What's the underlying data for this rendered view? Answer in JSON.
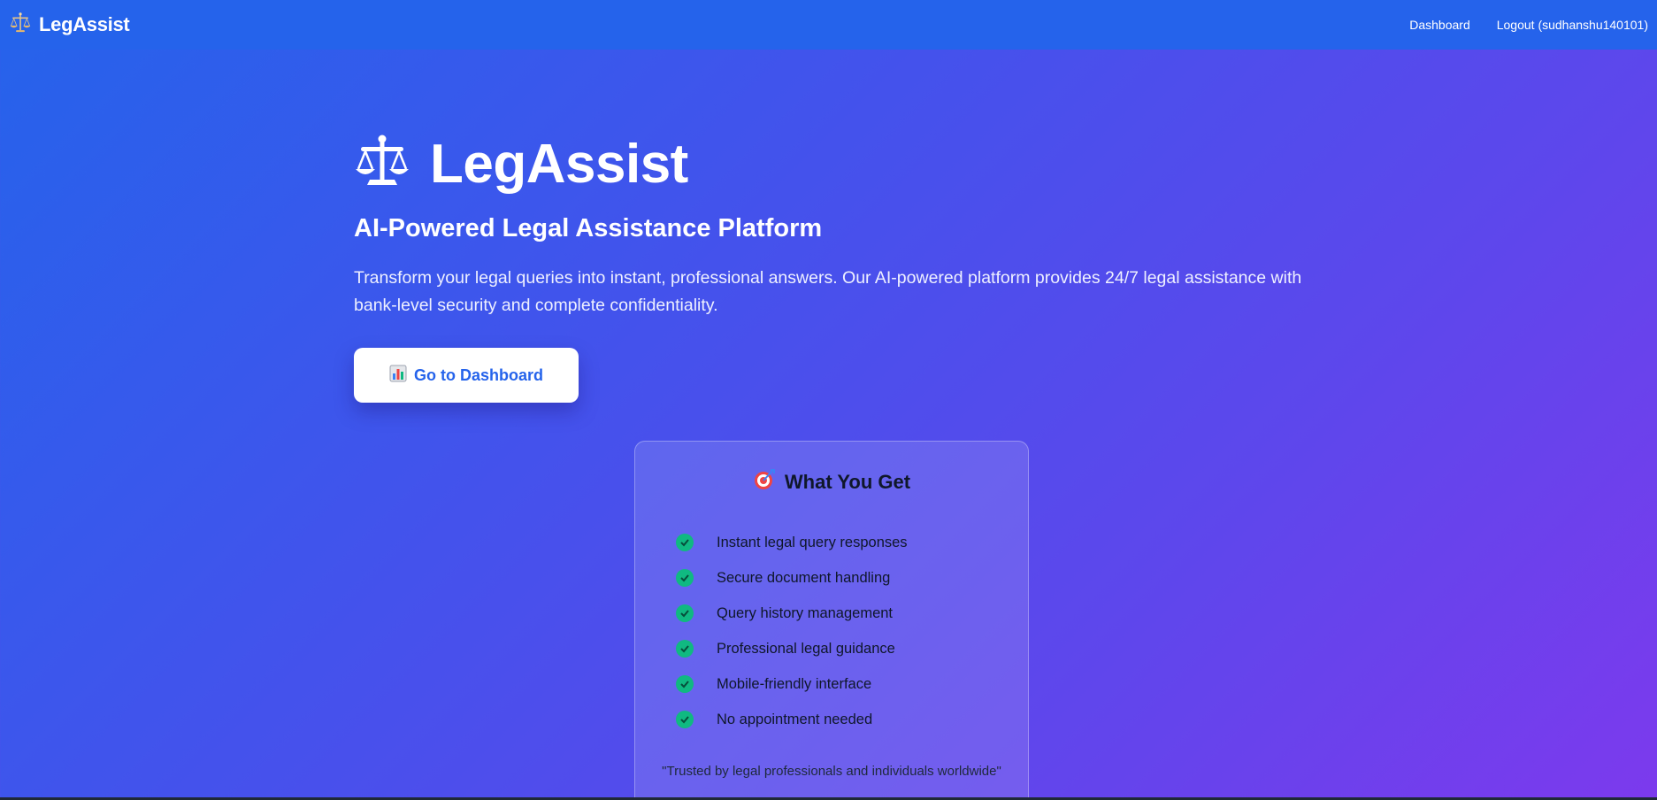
{
  "navbar": {
    "brand_icon": "scales-icon",
    "brand_name": "LegAssist",
    "links": [
      {
        "label": "Dashboard"
      },
      {
        "label": "Logout (sudhanshu140101)"
      }
    ],
    "background": "#2563eb"
  },
  "hero": {
    "icon": "scales-icon",
    "title": "LegAssist",
    "subtitle": "AI-Powered Legal Assistance Platform",
    "description": "Transform your legal queries into instant, professional answers. Our AI-powered platform provides 24/7 legal assistance with bank-level security and complete confidentiality.",
    "cta": {
      "icon": "bar-chart-icon",
      "label": "Go to Dashboard"
    }
  },
  "card": {
    "icon": "target-icon",
    "title": "What You Get",
    "features": [
      "Instant legal query responses",
      "Secure document handling",
      "Query history management",
      "Professional legal guidance",
      "Mobile-friendly interface",
      "No appointment needed"
    ],
    "quote": "\"Trusted by legal professionals and individuals worldwide\""
  },
  "colors": {
    "accent": "#2563eb",
    "gradient_end": "#7c3aed",
    "check": "#10b981"
  }
}
